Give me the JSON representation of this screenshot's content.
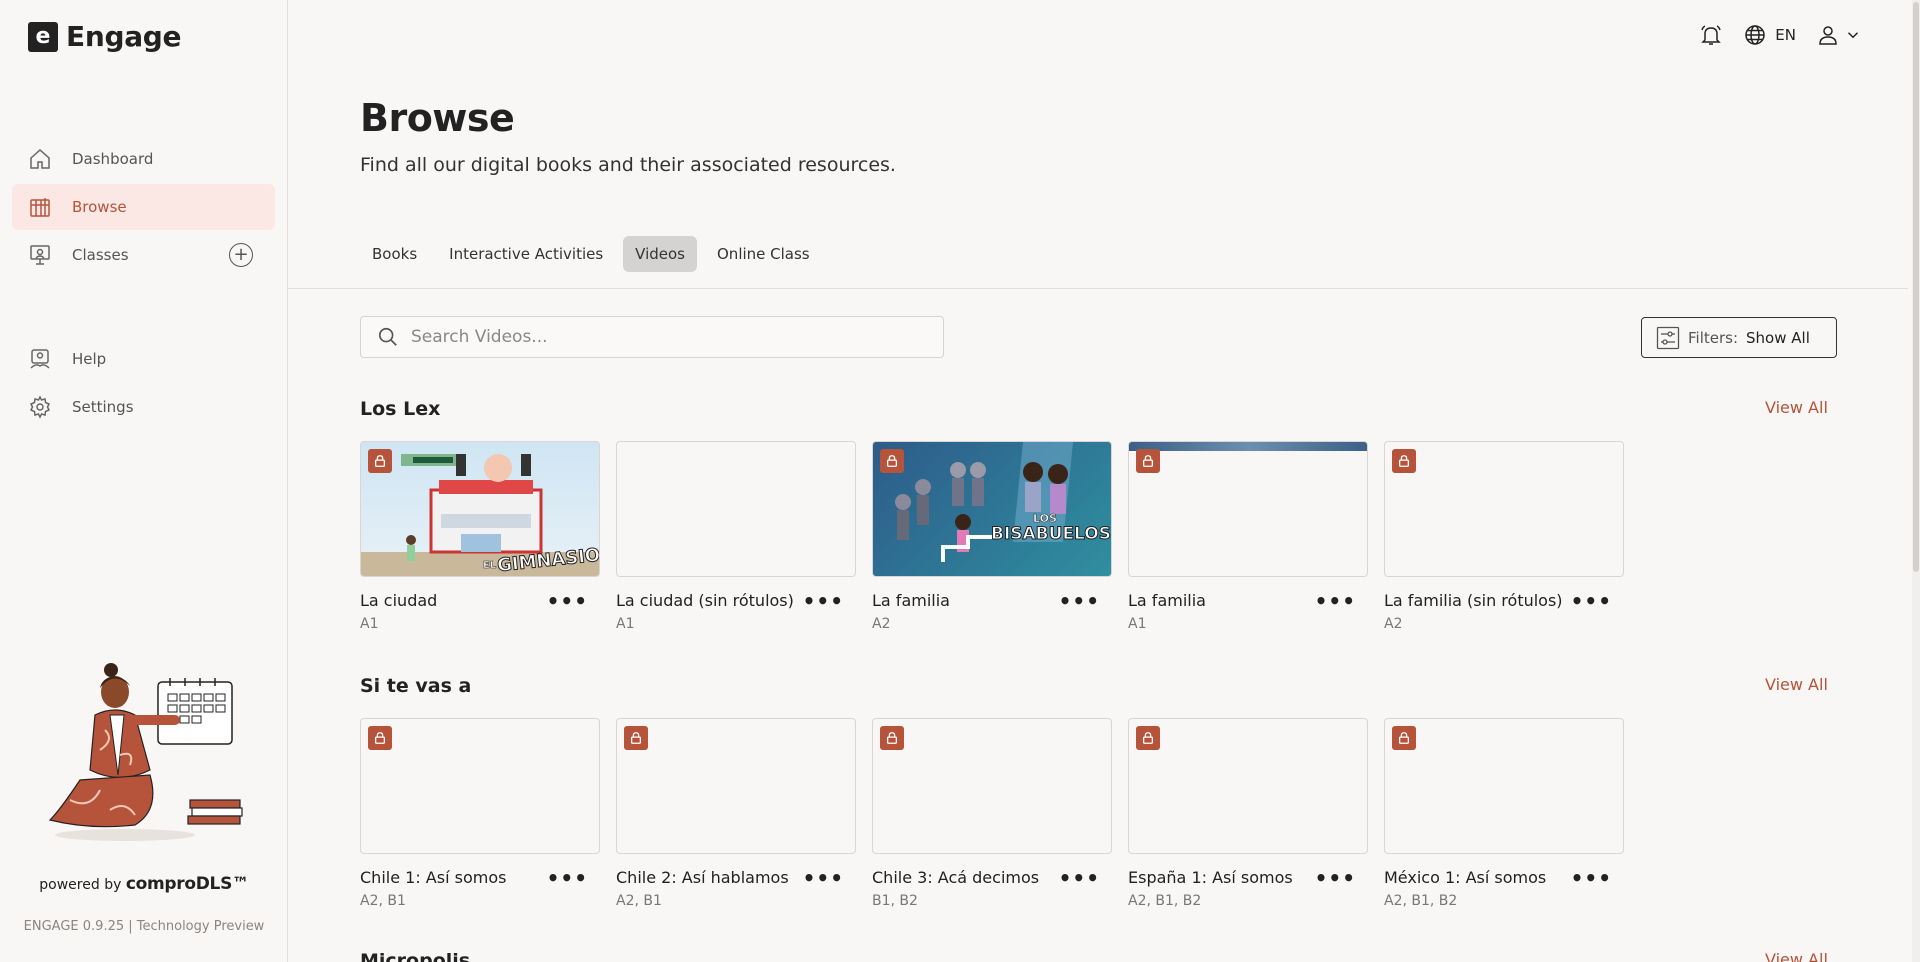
{
  "app": {
    "name": "Engage",
    "logo_letter": "e"
  },
  "sidebar": {
    "items": [
      {
        "label": "Dashboard",
        "icon": "home-icon"
      },
      {
        "label": "Browse",
        "icon": "grid-book-icon",
        "active": true
      },
      {
        "label": "Classes",
        "icon": "presentation-icon"
      },
      {
        "label": "Help",
        "icon": "help-icon"
      },
      {
        "label": "Settings",
        "icon": "gear-icon"
      }
    ],
    "add_class": "+",
    "powered_prefix": "powered by",
    "powered_brand": "comproDLS™",
    "version": "ENGAGE 0.9.25 | Technology Preview"
  },
  "topbar": {
    "language": "EN"
  },
  "page": {
    "title": "Browse",
    "subtitle": "Find all our digital books and their associated resources."
  },
  "tabs": [
    {
      "label": "Books"
    },
    {
      "label": "Interactive Activities"
    },
    {
      "label": "Videos",
      "active": true
    },
    {
      "label": "Online Class"
    }
  ],
  "search": {
    "placeholder": "Search Videos...",
    "value": ""
  },
  "filters": {
    "label": "Filters:",
    "value": "Show All"
  },
  "sections": [
    {
      "title": "Los Lex",
      "view_all": "View All",
      "cards": [
        {
          "title": "La ciudad",
          "level": "A1",
          "thumb": "gimnasio",
          "locked": true
        },
        {
          "title": "La ciudad (sin rótulos)",
          "level": "A1",
          "thumb": "blank",
          "locked": false
        },
        {
          "title": "La familia",
          "level": "A2",
          "thumb": "bisabuelos",
          "locked": true
        },
        {
          "title": "La familia",
          "level": "A1",
          "thumb": "blank-strip",
          "locked": true
        },
        {
          "title": "La familia (sin rótulos)",
          "level": "A2",
          "thumb": "blank",
          "locked": true
        }
      ]
    },
    {
      "title": "Si te vas a",
      "view_all": "View All",
      "cards": [
        {
          "title": "Chile 1: Así somos",
          "level": "A2, B1",
          "thumb": "blank",
          "locked": true
        },
        {
          "title": "Chile 2: Así hablamos",
          "level": "A2, B1",
          "thumb": "blank",
          "locked": true
        },
        {
          "title": "Chile 3: Acá decimos",
          "level": "B1, B2",
          "thumb": "blank",
          "locked": true
        },
        {
          "title": "España 1: Así somos",
          "level": "A2, B1, B2",
          "thumb": "blank",
          "locked": true
        },
        {
          "title": "México 1: Así somos",
          "level": "A2, B1, B2",
          "thumb": "blank",
          "locked": true
        }
      ]
    },
    {
      "title": "Micropolis",
      "view_all": "View All",
      "cards": []
    }
  ],
  "thumb_text": {
    "gimnasio_small": "EL",
    "gimnasio_big": "GIMNASIO",
    "bisabuelos_small": "LOS",
    "bisabuelos_big": "BISABUELOS"
  },
  "colors": {
    "accent": "#b5543a",
    "active_bg": "#fbe8e4",
    "background": "#f9f7f5"
  }
}
